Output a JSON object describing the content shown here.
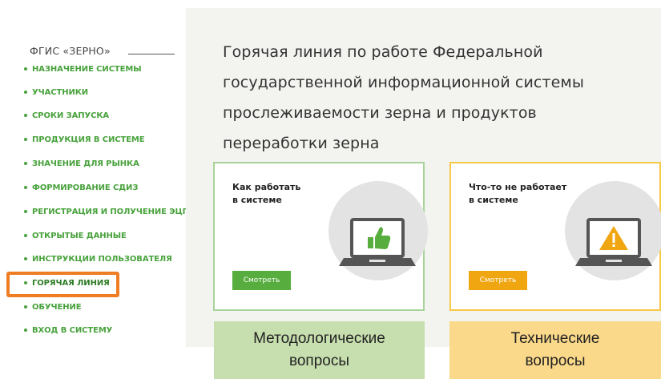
{
  "sidebar": {
    "brand": "ФГИС «ЗЕРНО»",
    "items": [
      {
        "label": "НАЗНАЧЕНИЕ СИСТЕМЫ"
      },
      {
        "label": "УЧАСТНИКИ"
      },
      {
        "label": "СРОКИ ЗАПУСКА"
      },
      {
        "label": "ПРОДУКЦИЯ В СИСТЕМЕ"
      },
      {
        "label": "ЗНАЧЕНИЕ ДЛЯ РЫНКА"
      },
      {
        "label": "ФОРМИРОВАНИЕ СДИЗ"
      },
      {
        "label": "РЕГИСТРАЦИЯ И ПОЛУЧЕНИЕ ЭЦП"
      },
      {
        "label": "ОТКРЫТЫЕ ДАННЫЕ"
      },
      {
        "label": "ИНСТРУКЦИИ ПОЛЬЗОВАТЕЛЯ"
      },
      {
        "label": "ГОРЯЧАЯ ЛИНИЯ",
        "active": true
      },
      {
        "label": "ОБУЧЕНИЕ"
      },
      {
        "label": "ВХОД В СИСТЕМУ"
      }
    ]
  },
  "main": {
    "title_lines": [
      "Горячая линия по работе Федеральной",
      "государственной информационной системы",
      "прослеживаемости зерна и продуктов",
      "переработки зерна"
    ],
    "cards": [
      {
        "title_line1": "Как работать",
        "title_line2": "в системе",
        "button": "Смотреть",
        "icon": "laptop-thumbs-up-icon",
        "accent": "#58ad3f"
      },
      {
        "title_line1": "Что-то не работает",
        "title_line2": "в системе",
        "button": "Смотреть",
        "icon": "laptop-warning-icon",
        "accent": "#f0a611"
      }
    ]
  },
  "captions": {
    "methodological_line1": "Методологические",
    "methodological_line2": "вопросы",
    "technical_line1": "Технические",
    "technical_line2": "вопросы"
  },
  "colors": {
    "nav_green": "#48a23c",
    "highlight_orange": "#ef7d23",
    "caption_green": "#c7deae",
    "caption_yellow": "#fbd98a"
  }
}
